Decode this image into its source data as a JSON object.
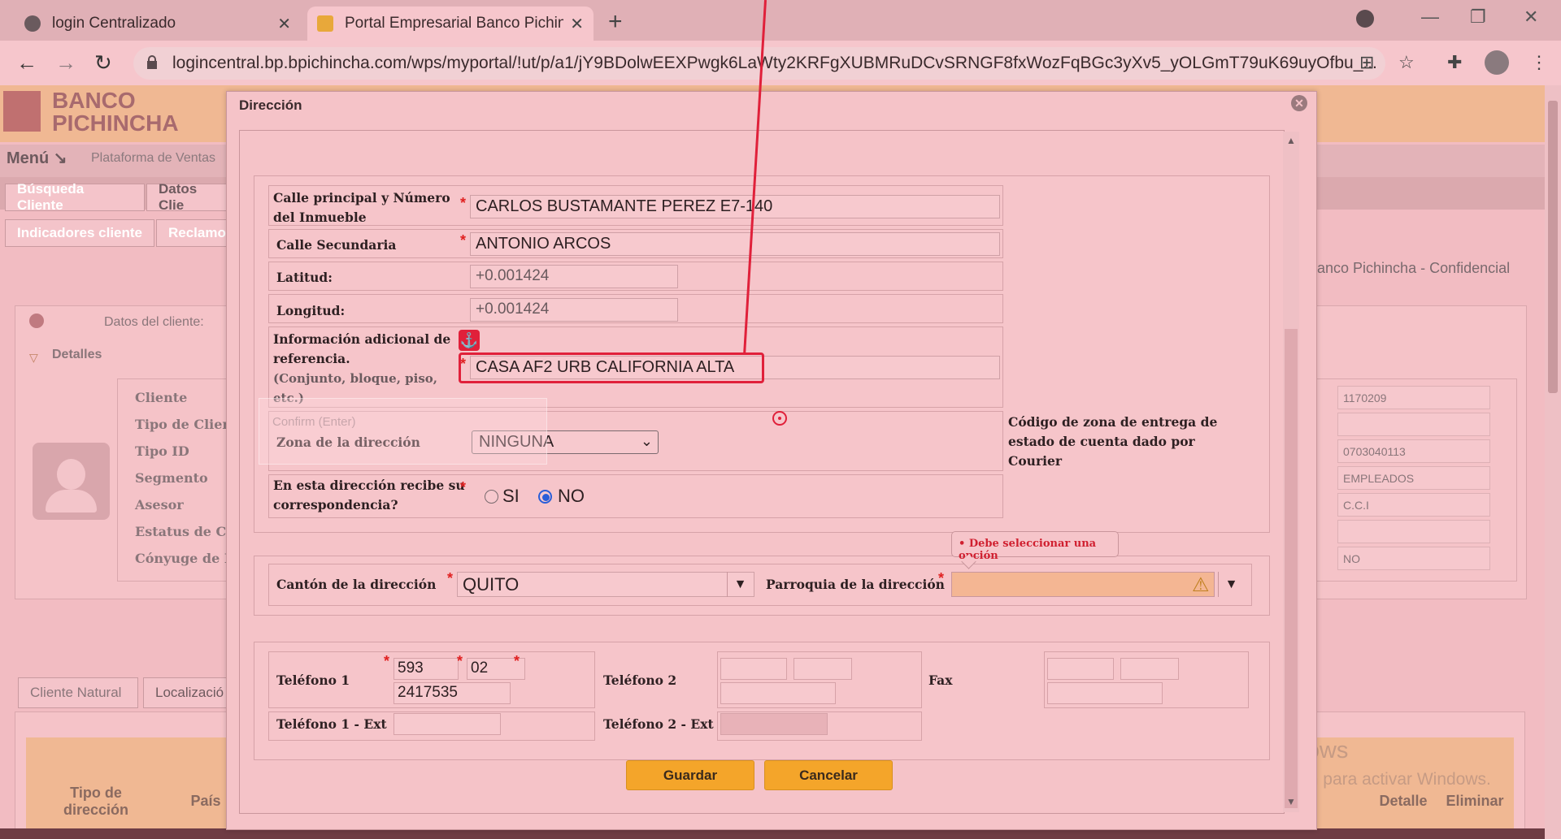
{
  "browser": {
    "tabs": [
      {
        "title": "login Centralizado",
        "active": false
      },
      {
        "title": "Portal Empresarial Banco Pichincha",
        "active": true
      }
    ],
    "url": "logincentral.bp.bpichincha.com/wps/myportal/!ut/p/a1/jY9BDolwEEXPwgk6LaWty2KRFgXUBMRuDCvSRNGF8fxWozFqBGc3yXv5_yOLGmT79uK69uyOfbu_..."
  },
  "page": {
    "logo_line1": "BANCO",
    "logo_line2": "PICHINCHA",
    "menu_label": "Menú ↘",
    "platform": "Plataforma de Ventas",
    "tabs_row1": [
      "Búsqueda Cliente",
      "Datos Clie"
    ],
    "tabs_row2": [
      "Indicadores cliente",
      "Reclamo"
    ],
    "confidential": "anco Pichincha - Confidencial",
    "client_data_label": "Datos del cliente:",
    "details_label": "Detalles",
    "fields": [
      "Cliente",
      "Tipo de Client",
      "Tipo ID",
      "Segmento",
      "Asesor",
      "Estatus de Cli",
      "Cónyuge de E"
    ],
    "field_values": [
      "1170209",
      "",
      "0703040113",
      "EMPLEADOS",
      "C.C.I",
      "",
      "NO"
    ],
    "bottom_tabs": [
      "Cliente Natural",
      "Localizació"
    ],
    "table_headers": [
      "Tipo de dirección",
      "País",
      "Detalle",
      "Eliminar"
    ],
    "watermark_title": "Activar Windows",
    "watermark_sub": "Ve a Configuración para activar Windows."
  },
  "dialog": {
    "title": "Dirección",
    "calle_principal_label": "Calle principal y Número del Inmueble",
    "calle_principal_value": "CARLOS BUSTAMANTE PEREZ E7-140",
    "calle_secundaria_label": "Calle Secundaria",
    "calle_secundaria_value": "ANTONIO ARCOS",
    "latitud_label": "Latitud:",
    "latitud_value": "+0.001424",
    "longitud_label": "Longitud:",
    "longitud_value": "+0.001424",
    "info_label": "Información adicional de referencia.",
    "info_sub": "(Conjunto, bloque, piso, etc.)",
    "info_value": "CASA AF2 URB CALIFORNIA ALTA",
    "zona_label": "Zona de la dirección",
    "zona_value": "NINGUNA",
    "zona_help": "Código de zona de entrega de estado de cuenta dado por Courier",
    "correspondencia_label": "En esta dirección recibe su correspondencia?",
    "radio_si": "SI",
    "radio_no": "NO",
    "ghost_confirm": "Confirm (Enter)",
    "canton_label": "Cantón de la dirección",
    "canton_value": "QUITO",
    "parroquia_label": "Parroquia de la dirección",
    "tooltip": "• Debe seleccionar una opción",
    "telefono1_label": "Teléfono 1",
    "telefono1_country": "593",
    "telefono1_area": "02",
    "telefono1_number": "2417535",
    "telefono2_label": "Teléfono 2",
    "fax_label": "Fax",
    "telefono1_ext_label": "Teléfono 1 - Ext",
    "telefono2_ext_label": "Teléfono 2 - Ext",
    "guardar": "Guardar",
    "cancelar": "Cancelar"
  }
}
